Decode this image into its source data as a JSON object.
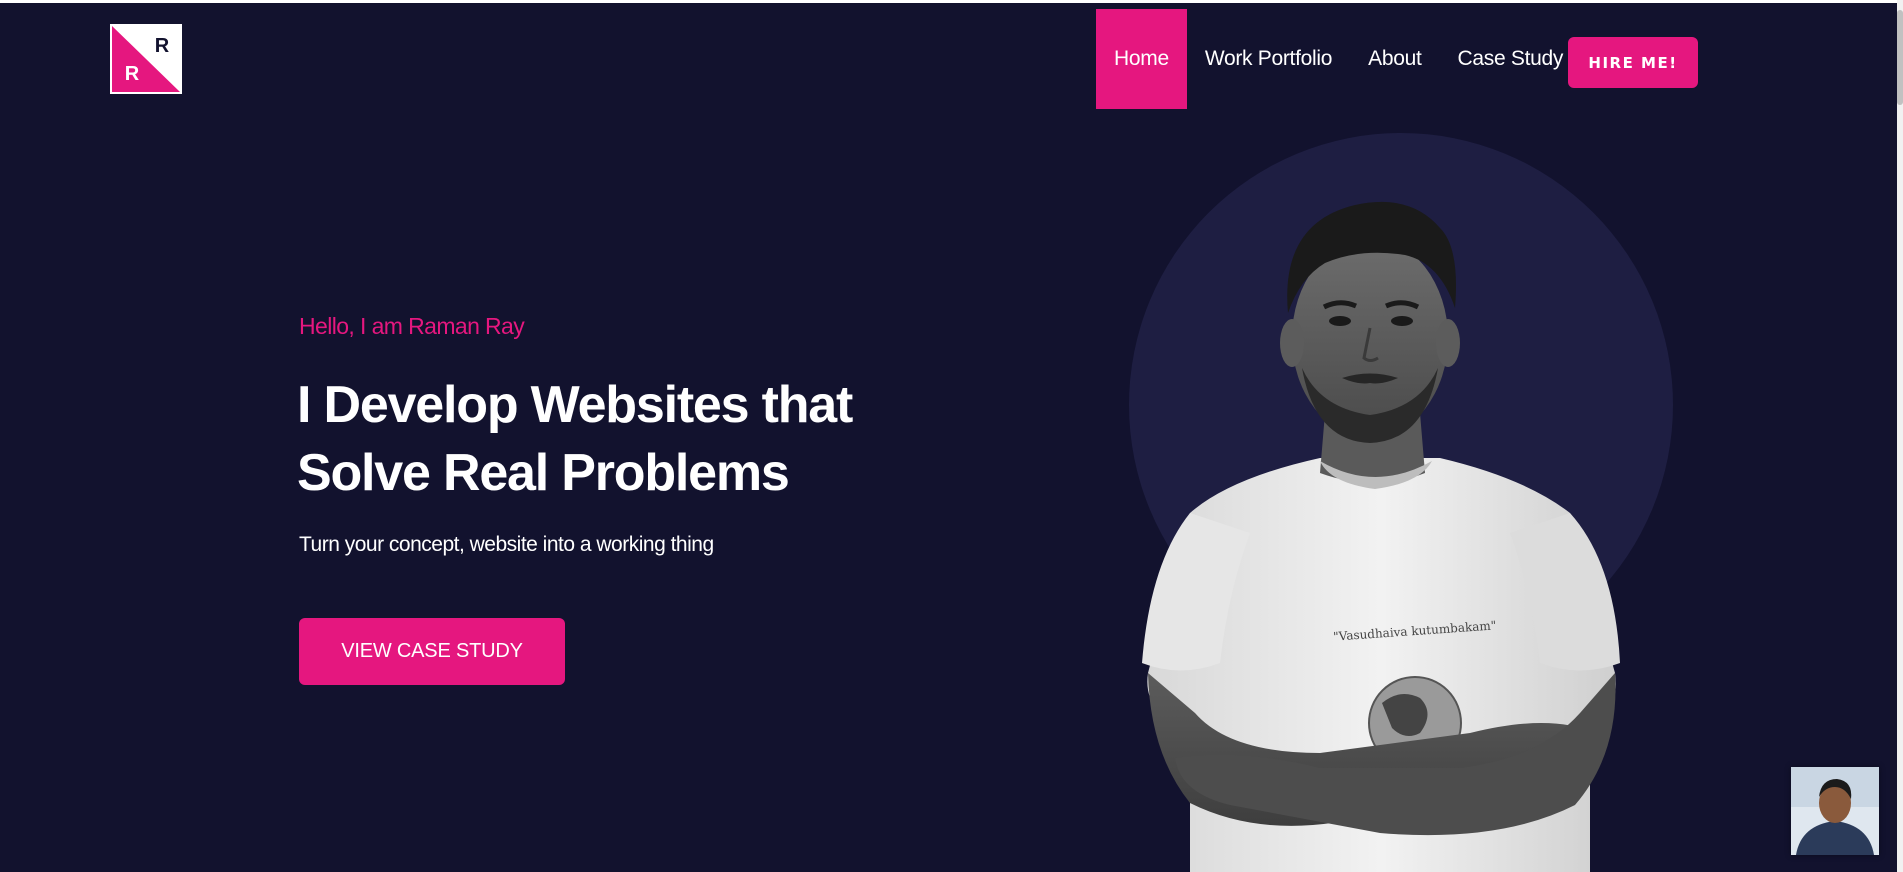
{
  "logo": {
    "letter_top": "R",
    "letter_bottom": "R",
    "accent_color": "#e5177f",
    "dark_color": "#12122e"
  },
  "nav": {
    "items": [
      {
        "label": "Home",
        "active": true
      },
      {
        "label": "Work Portfolio",
        "active": false
      },
      {
        "label": "About",
        "active": false
      },
      {
        "label": "Case Study",
        "active": false
      }
    ],
    "hire_label": "HIRE ME!"
  },
  "hero": {
    "greeting": "Hello, I am Raman Ray",
    "headline_line1": "I Develop Websites that",
    "headline_line2": "Solve Real Problems",
    "subtitle": "Turn your concept, website into a working thing",
    "cta_label": "VIEW CASE STUDY",
    "tshirt_text": "\"Vasudhaiva kutumbakam\""
  },
  "colors": {
    "background": "#12122e",
    "accent": "#e5177f",
    "circle": "#1e1e42",
    "text": "#ffffff"
  },
  "icons": {
    "portrait": "person-photo-icon",
    "chat": "chat-avatar-icon"
  }
}
